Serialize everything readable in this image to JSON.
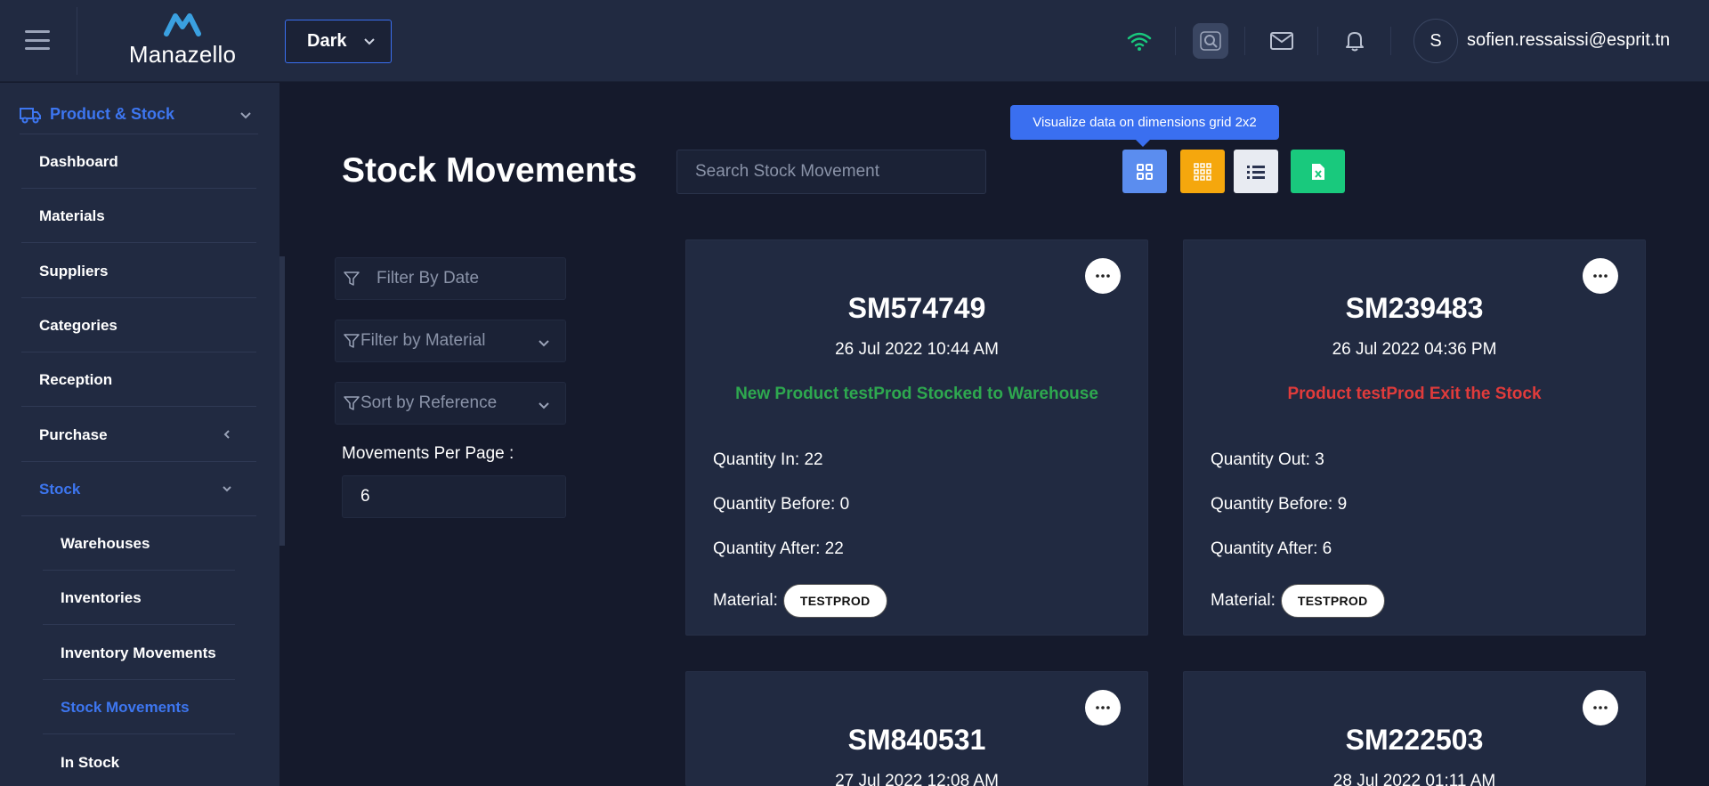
{
  "header": {
    "logo_text": "Manazello",
    "theme_selected": "Dark",
    "user_initial": "S",
    "user_email": "sofien.ressaissi@esprit.tn"
  },
  "sidebar": {
    "section_label": "Product & Stock",
    "items": [
      {
        "label": "Dashboard"
      },
      {
        "label": "Materials"
      },
      {
        "label": "Suppliers"
      },
      {
        "label": "Categories"
      },
      {
        "label": "Reception"
      },
      {
        "label": "Purchase"
      },
      {
        "label": "Stock"
      }
    ],
    "stock_sub": [
      {
        "label": "Warehouses"
      },
      {
        "label": "Inventories"
      },
      {
        "label": "Inventory Movements"
      },
      {
        "label": "Stock Movements"
      },
      {
        "label": "In Stock"
      }
    ]
  },
  "main": {
    "title": "Stock Movements",
    "search_placeholder": "Search Stock Movement",
    "tooltip": "Visualize data on dimensions grid 2x2",
    "filters": {
      "date_placeholder": "Filter By Date",
      "material": "Filter by Material",
      "sort": "Sort by Reference"
    },
    "per_page_label": "Movements Per Page :",
    "per_page_value": "6"
  },
  "cards": [
    {
      "ref": "SM574749",
      "date": "26 Jul 2022 10:44 AM",
      "message": "New Product testProd Stocked to Warehouse",
      "message_color": "#2ea84f",
      "qty_label": "Quantity In: 22",
      "before": "Quantity Before: 0",
      "after": "Quantity After: 22",
      "material_label": "Material:",
      "material": "TESTPROD"
    },
    {
      "ref": "SM239483",
      "date": "26 Jul 2022 04:36 PM",
      "message": "Product testProd Exit the Stock",
      "message_color": "#e03b3b",
      "qty_label": "Quantity Out: 3",
      "before": "Quantity Before: 9",
      "after": "Quantity After: 6",
      "material_label": "Material:",
      "material": "TESTPROD"
    },
    {
      "ref": "SM840531",
      "date": "27 Jul 2022 12:08 AM"
    },
    {
      "ref": "SM222503",
      "date": "28 Jul 2022 01:11 AM"
    }
  ],
  "colors": {
    "accent": "#3a6ff0",
    "grid_btn": "#5b8def",
    "grid3_btn": "#f5a70d",
    "list_btn": "#e8ebf2",
    "excel_btn": "#19c97d",
    "wifi": "#19c97d"
  }
}
